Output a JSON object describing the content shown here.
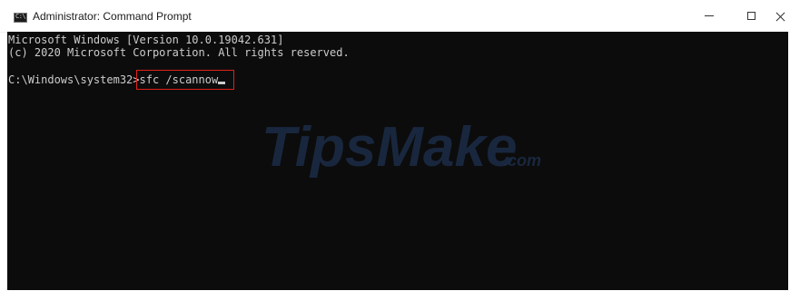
{
  "window": {
    "title": "Administrator: Command Prompt",
    "icon": "cmd-icon",
    "controls": [
      "minimize-icon",
      "maximize-icon",
      "close-icon"
    ]
  },
  "console": {
    "lines": [
      "Microsoft Windows [Version 10.0.19042.631]",
      "(c) 2020 Microsoft Corporation. All rights reserved."
    ],
    "prompt": "C:\\Windows\\system32>",
    "command": "sfc /scannow",
    "background": "#0c0c0c",
    "text_color": "#cccccc"
  },
  "annotation": {
    "highlight_color": "#e0201b"
  },
  "watermark": {
    "brand": "TipsMake",
    "suffix": ".com",
    "color": "#1b2a44"
  }
}
